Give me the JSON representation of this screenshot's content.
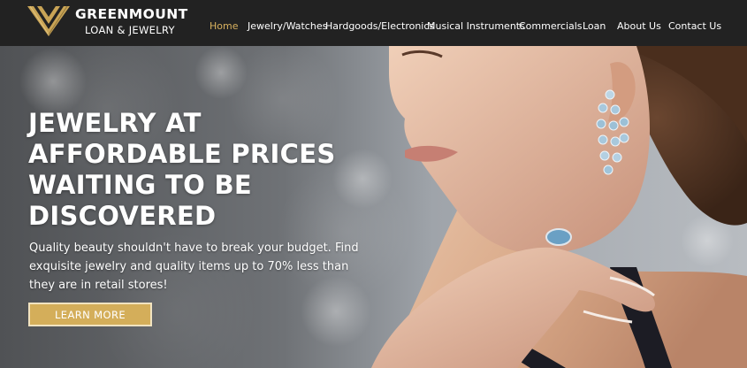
{
  "brand": {
    "name": "GREENMOUNT",
    "tagline": "LOAN & JEWELRY",
    "accent_color": "#d4ae5a"
  },
  "nav": {
    "items": [
      {
        "label": "Home",
        "active": true
      },
      {
        "label": "Jewelry/Watches",
        "active": false
      },
      {
        "label": "Hardgoods/Electronics",
        "active": false
      },
      {
        "label": "Musical Instruments",
        "active": false
      },
      {
        "label": "Commercials",
        "active": false
      },
      {
        "label": "Loan",
        "active": false
      },
      {
        "label": "About Us",
        "active": false
      },
      {
        "label": "Contact Us",
        "active": false
      }
    ]
  },
  "hero": {
    "headline_lines": [
      "JEWELRY AT",
      "AFFORDABLE PRICES",
      "WAITING TO BE",
      "DISCOVERED"
    ],
    "subtext": "Quality beauty shouldn't have to break your budget. Find exquisite jewelry and quality items up to 70% less than they are in retail stores!",
    "cta_label": "LEARN MORE"
  }
}
